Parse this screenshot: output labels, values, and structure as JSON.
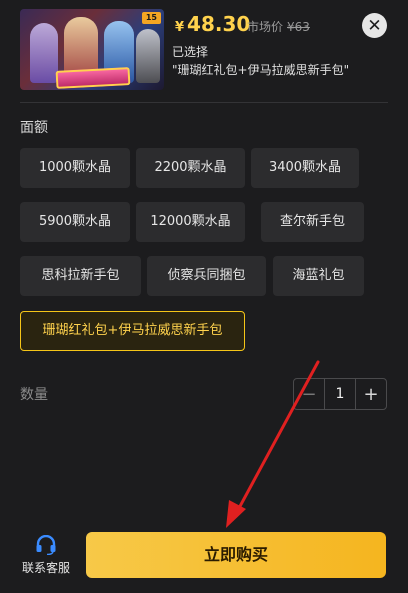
{
  "product": {
    "thumbnail_badge": "15",
    "currency": "¥",
    "price": "48.30",
    "market_label": "市场价",
    "market_price": "¥63",
    "selected_label": "已选择",
    "selected_value": "\"珊瑚红礼包+伊马拉威思新手包\""
  },
  "denomination": {
    "title": "面额",
    "options": [
      {
        "label": "1000颗水晶",
        "active": false
      },
      {
        "label": "2200颗水晶",
        "active": false
      },
      {
        "label": "3400颗水晶",
        "active": false
      },
      {
        "label": "5900颗水晶",
        "active": false
      },
      {
        "label": "12000颗水晶",
        "active": false
      },
      {
        "label": "查尔新手包",
        "active": false
      },
      {
        "label": "思科拉新手包",
        "active": false
      },
      {
        "label": "侦察兵同捆包",
        "active": false
      },
      {
        "label": "海蓝礼包",
        "active": false
      },
      {
        "label": "珊瑚红礼包+伊马拉威思新手包",
        "active": true
      }
    ]
  },
  "quantity": {
    "label": "数量",
    "minus": "−",
    "value": "1",
    "plus": "+"
  },
  "footer": {
    "support_label": "联系客服",
    "buy_label": "立即购买"
  },
  "colors": {
    "background": "#1c1c1e",
    "accent": "#ffd24d",
    "buy_button": "#f5b51f",
    "option_bg": "#2c2c2e",
    "support_icon": "#3a8bff",
    "arrow": "#e02020"
  },
  "icons": {
    "close": "close-icon",
    "support": "headset-icon",
    "annotation": "red-arrow"
  }
}
